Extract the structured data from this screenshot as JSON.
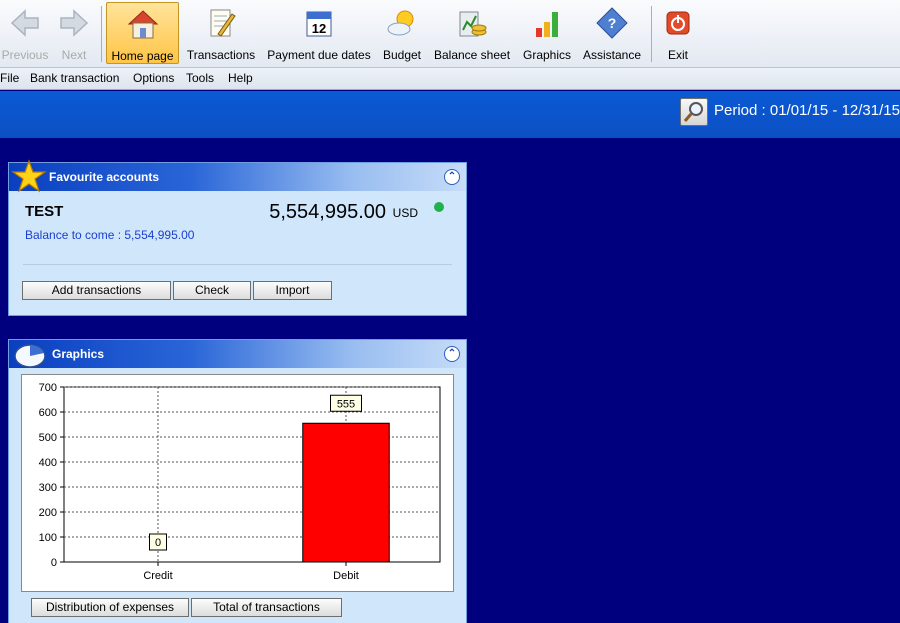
{
  "toolbar": {
    "items": [
      {
        "label": "Previous",
        "icon": "back-arrow-icon",
        "disabled": true
      },
      {
        "label": "Next",
        "icon": "forward-arrow-icon",
        "disabled": true
      },
      {
        "label": "Home page",
        "icon": "home-icon",
        "active": true
      },
      {
        "label": "Transactions",
        "icon": "notepad-pencil-icon"
      },
      {
        "label": "Payment due dates",
        "icon": "calendar-icon"
      },
      {
        "label": "Budget",
        "icon": "sun-cloud-icon"
      },
      {
        "label": "Balance sheet",
        "icon": "money-icon"
      },
      {
        "label": "Graphics",
        "icon": "bar-chart-icon"
      },
      {
        "label": "Assistance",
        "icon": "help-diamond-icon"
      },
      {
        "label": "Exit",
        "icon": "power-icon"
      }
    ],
    "calendar_day": "12"
  },
  "menu": [
    "File",
    "Bank transaction",
    "Options",
    "Tools",
    "Help"
  ],
  "period": {
    "text": "Period : 01/01/15 - 12/31/15"
  },
  "favourites": {
    "title": "Favourite accounts",
    "account_name": "TEST",
    "amount": "5,554,995.00",
    "currency": "USD",
    "balance_to_come": "Balance to come : 5,554,995.00",
    "status_color": "#21b04c",
    "buttons": [
      "Add transactions",
      "Check",
      "Import"
    ]
  },
  "graphics": {
    "title": "Graphics",
    "buttons": [
      "Distribution of expenses",
      "Total of transactions"
    ]
  },
  "chart_data": {
    "type": "bar",
    "categories": [
      "Credit",
      "Debit"
    ],
    "values": [
      0,
      555
    ],
    "data_labels": [
      "0",
      "555"
    ],
    "colors": [
      "#ff0000",
      "#ff0000"
    ],
    "ylim": [
      0,
      700
    ],
    "yticks": [
      "0",
      "100",
      "200",
      "300",
      "400",
      "500",
      "600",
      "700"
    ],
    "grid": true,
    "title": "",
    "xlabel": "",
    "ylabel": ""
  },
  "colors": {
    "background": "#00007f",
    "accent": "#0c4fc4",
    "panel": "#cfe6fb"
  }
}
